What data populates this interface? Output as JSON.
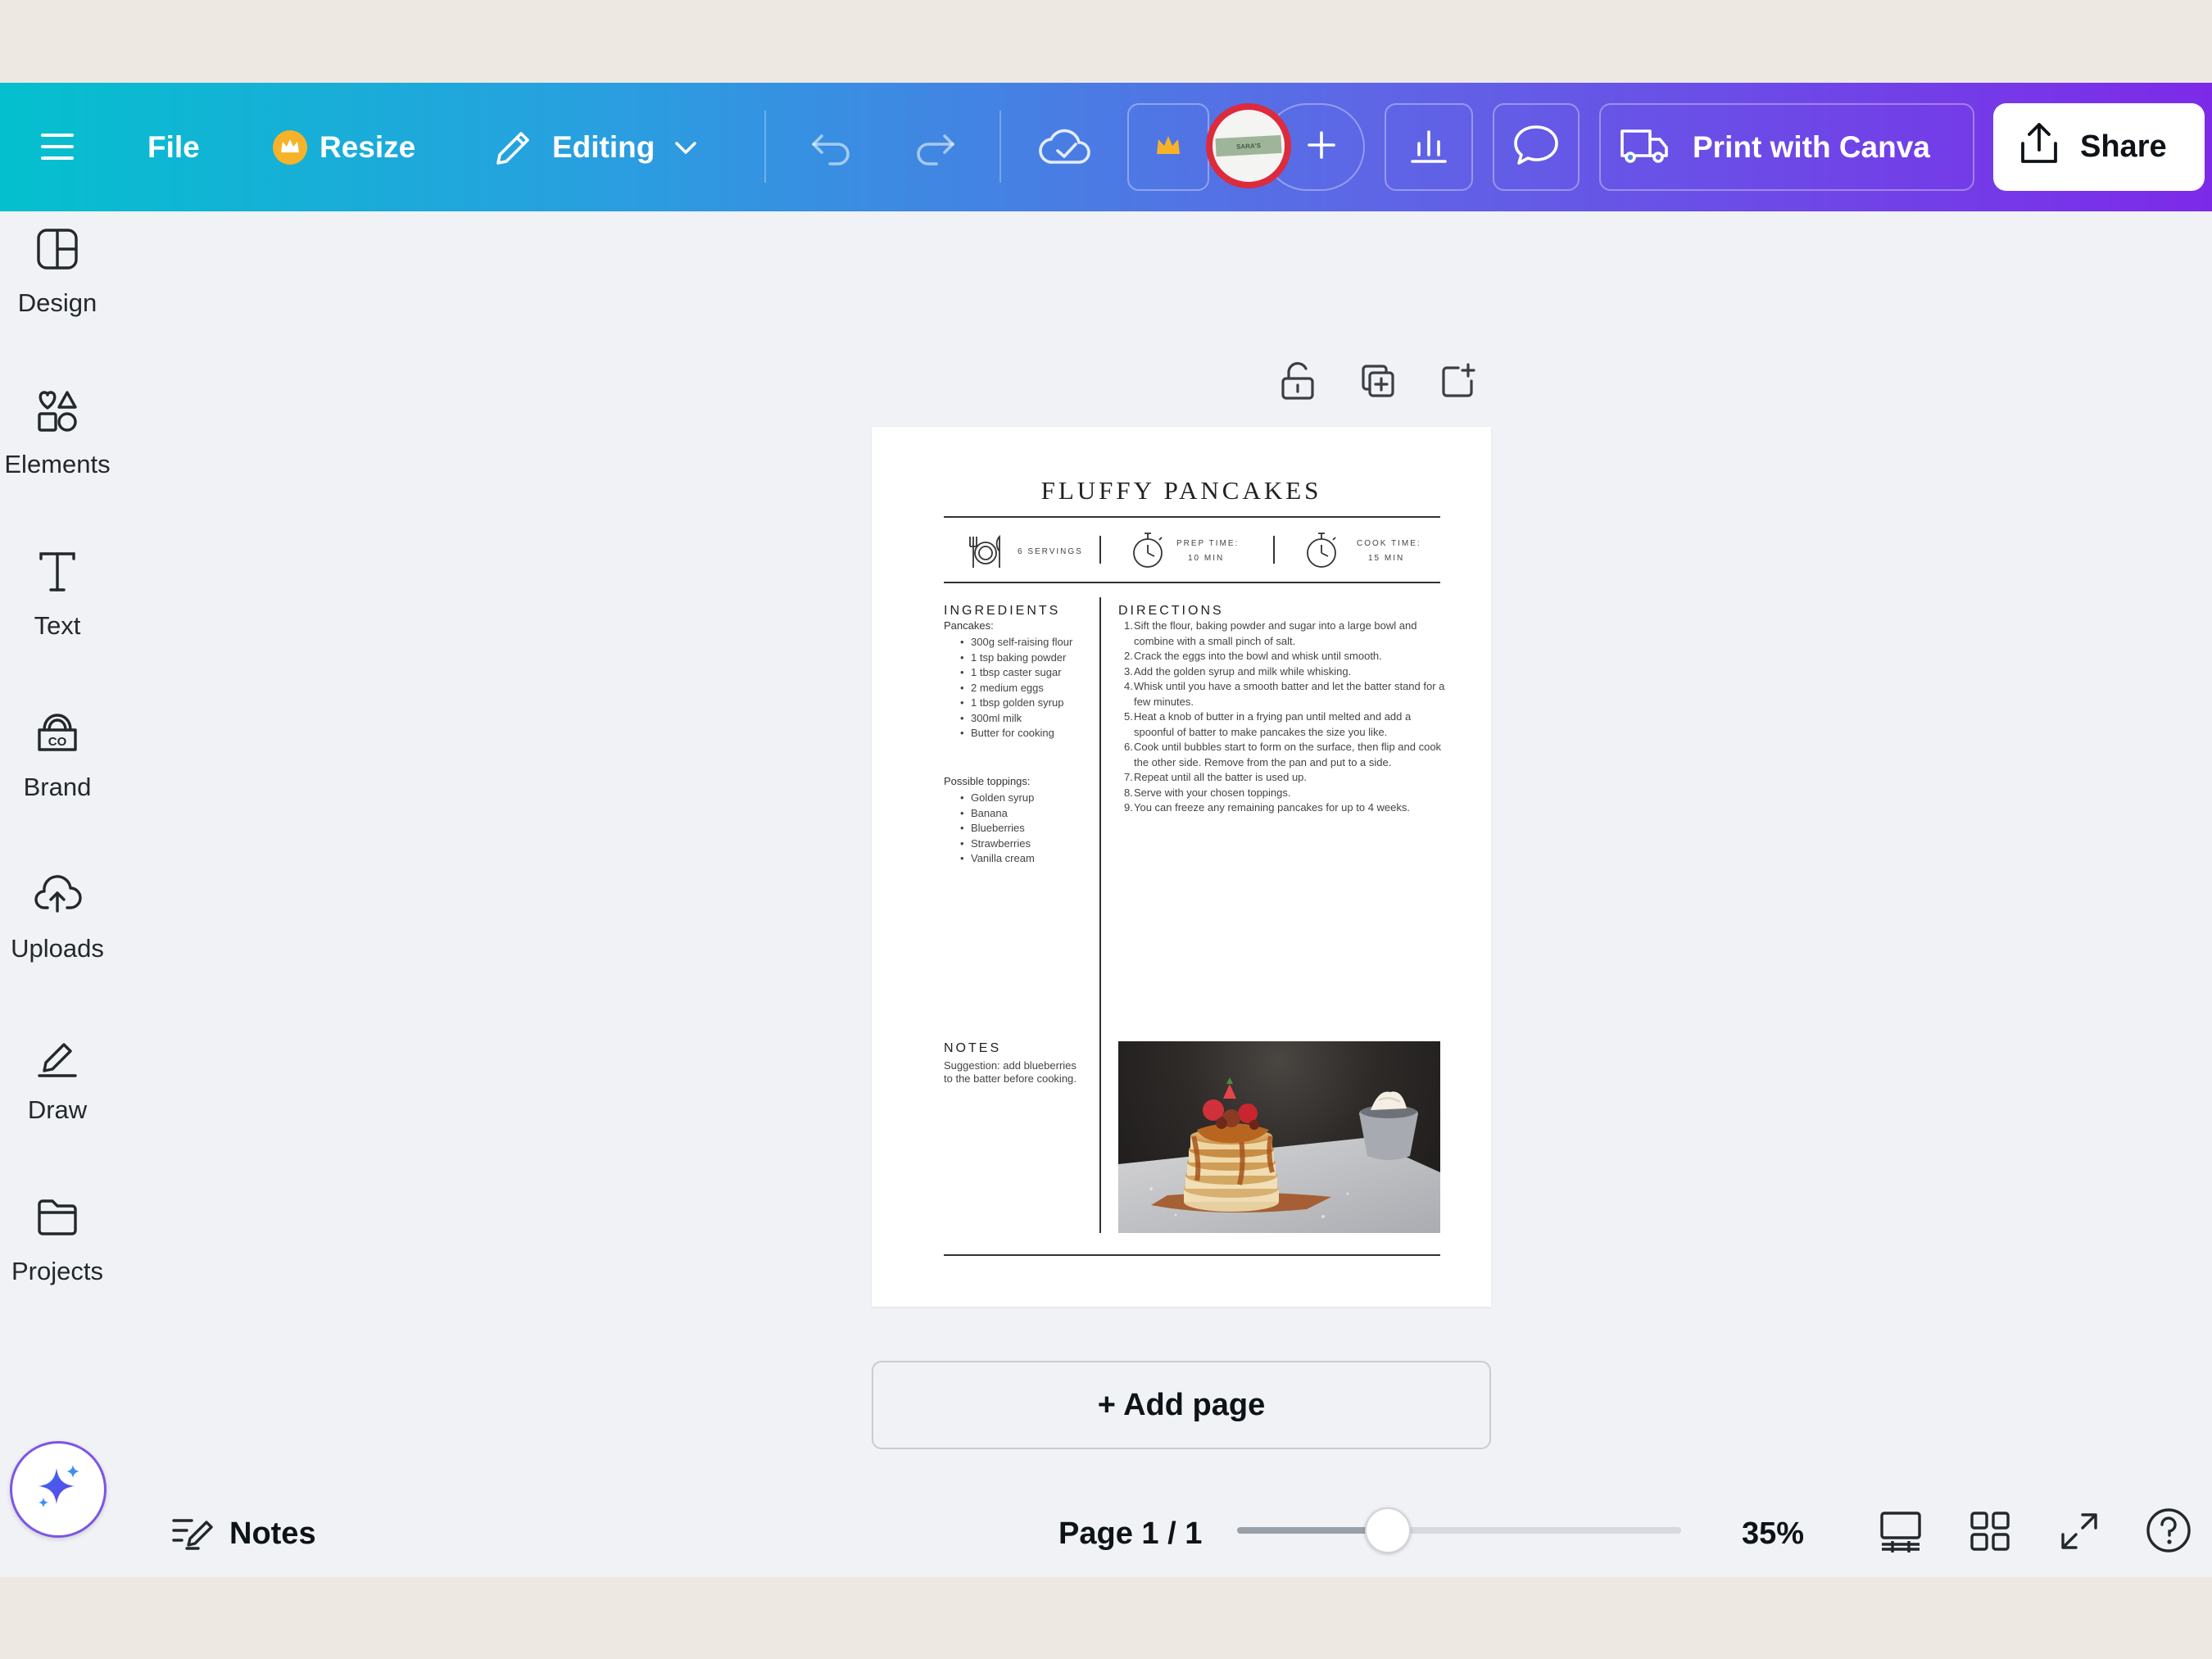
{
  "colors": {
    "topbar_gradient_start": "#04c0ce",
    "topbar_gradient_end": "#7d2ae8",
    "crown": "#f6b32a",
    "app_background": "#f0f2f5"
  },
  "topbar": {
    "menu_icon": "hamburger-icon",
    "file_label": "File",
    "resize_label": "Resize",
    "editing_label": "Editing",
    "print_label": "Print with Canva",
    "share_label": "Share",
    "avatar_text": "SARA'S"
  },
  "sidebar": {
    "items": [
      {
        "label": "Design",
        "icon": "design-icon"
      },
      {
        "label": "Elements",
        "icon": "elements-icon"
      },
      {
        "label": "Text",
        "icon": "text-icon"
      },
      {
        "label": "Brand",
        "icon": "brand-icon"
      },
      {
        "label": "Uploads",
        "icon": "uploads-icon"
      },
      {
        "label": "Draw",
        "icon": "draw-icon"
      },
      {
        "label": "Projects",
        "icon": "projects-icon"
      }
    ]
  },
  "recipe": {
    "title": "FLUFFY PANCAKES",
    "servings": "6 SERVINGS",
    "prep_time_label": "PREP TIME:",
    "prep_time_value": "10 MIN",
    "cook_time_label": "COOK TIME:",
    "cook_time_value": "15 MIN",
    "ingredients_heading": "INGREDIENTS",
    "pancakes_label": "Pancakes:",
    "pancake_ingredients": [
      "300g self-raising flour",
      "1 tsp baking powder",
      "1 tbsp caster sugar",
      "2 medium eggs",
      "1 tbsp golden syrup",
      "300ml milk",
      "Butter for cooking"
    ],
    "toppings_label": "Possible toppings:",
    "toppings": [
      "Golden syrup",
      "Banana",
      "Blueberries",
      "Strawberries",
      "Vanilla cream"
    ],
    "directions_heading": "DIRECTIONS",
    "directions": [
      "Sift the flour, baking powder and sugar into a large bowl and combine with a small pinch of salt.",
      "Crack the eggs into the bowl and whisk until smooth.",
      "Add the golden syrup and milk while whisking.",
      "Whisk until you have a smooth batter and let the batter stand for a few minutes.",
      "Heat a knob of butter in a frying pan until melted and add a spoonful of batter to make pancakes the size you like.",
      "Cook until bubbles start to form on the surface, then flip and cook the other side. Remove from the pan and put to a side.",
      "Repeat until all the batter is used up.",
      "Serve with your chosen toppings.",
      "You can freeze any remaining pancakes for up to 4 weeks."
    ],
    "notes_heading": "NOTES",
    "notes_text": "Suggestion: add blueberries to the batter before cooking."
  },
  "canvas": {
    "add_page_label": "+ Add page"
  },
  "bottombar": {
    "notes_label": "Notes",
    "page_indicator": "Page 1 / 1",
    "zoom_label": "35%",
    "zoom_fraction": 0.34
  }
}
